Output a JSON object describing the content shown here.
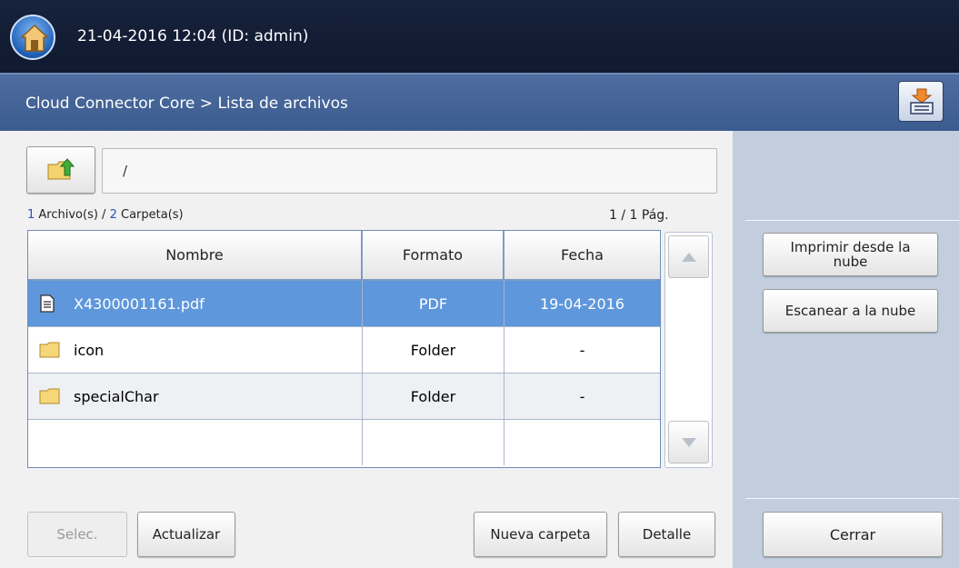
{
  "status_bar": {
    "datetime": "21-04-2016 12:04 (ID: admin)"
  },
  "title_bar": {
    "breadcrumb": "Cloud Connector Core > Lista de archivos"
  },
  "path": {
    "value": "/"
  },
  "summary": {
    "file_count": "1",
    "files_label": " Archivo(s) / ",
    "folder_count": "2",
    "folders_label": " Carpeta(s)",
    "page": "1 / 1 Pág."
  },
  "table": {
    "headers": {
      "name": "Nombre",
      "format": "Formato",
      "date": "Fecha"
    },
    "rows": [
      {
        "name": "X4300001161.pdf",
        "format": "PDF",
        "date": "19-04-2016",
        "icon": "document-icon"
      },
      {
        "name": "icon",
        "format": "Folder",
        "date": "-",
        "icon": "folder-icon"
      },
      {
        "name": "specialChar",
        "format": "Folder",
        "date": "-",
        "icon": "folder-icon"
      }
    ]
  },
  "side_buttons": {
    "print_cloud_line1": "Imprimir desde la",
    "print_cloud_line2": "nube",
    "scan_cloud": "Escanear a la nube",
    "close": "Cerrar"
  },
  "bottom_buttons": {
    "select": "Selec.",
    "refresh": "Actualizar",
    "new_folder": "Nueva carpeta",
    "detail": "Detalle"
  },
  "colors": {
    "selected_row": "#5e97dc",
    "title_bar": "#4e6da0",
    "top_bar": "#17233b"
  }
}
